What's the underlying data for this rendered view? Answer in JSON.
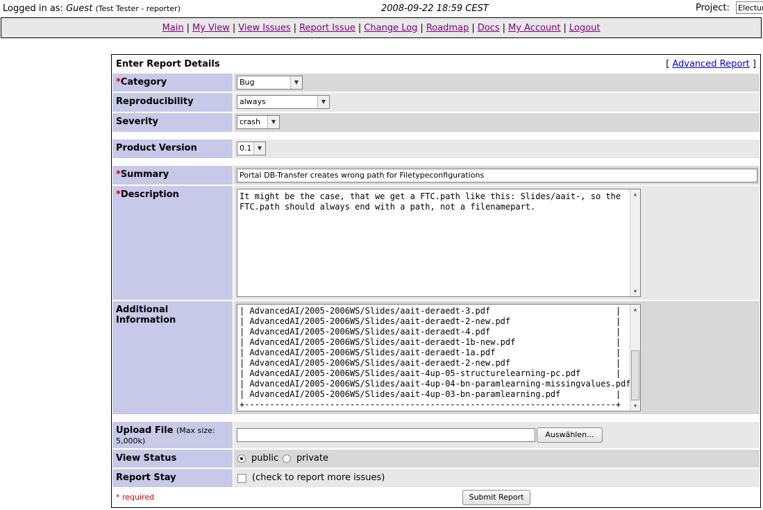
{
  "header": {
    "logged_in_prefix": "Logged in as:",
    "user": "Guest",
    "user_detail": "(Test Tester - reporter)",
    "datetime": "2008-09-22 18:59 CEST",
    "project_label": "Project:",
    "project_value": "Electure"
  },
  "menu": {
    "items": [
      "Main",
      "My View",
      "View Issues",
      "Report Issue",
      "Change Log",
      "Roadmap",
      "Docs",
      "My Account",
      "Logout"
    ],
    "separator": "|"
  },
  "form": {
    "title": "Enter Report Details",
    "advanced_link": "Advanced Report",
    "bracket_open": "[",
    "bracket_close": "]",
    "required_mark": "*",
    "category": {
      "label": "Category",
      "value": "Bug"
    },
    "reproducibility": {
      "label": "Reproducibility",
      "value": "always"
    },
    "severity": {
      "label": "Severity",
      "value": "crash"
    },
    "product_version": {
      "label": "Product Version",
      "value": "0.1"
    },
    "summary": {
      "label": "Summary",
      "value": "Portal DB-Transfer creates wrong path for Filetypeconfigurations"
    },
    "description": {
      "label": "Description",
      "value": "It might be the case, that we get a FTC.path like this: Slides/aait-, so the\nFTC.path should always end with a path, not a filenamepart."
    },
    "additional_info": {
      "label": "Additional Information",
      "value": "| AdvancedAI/2005-2006WS/Slides/aait-deraedt-3.pdf                         |\n| AdvancedAI/2005-2006WS/Slides/aait-deraedt-2-new.pdf                     |\n| AdvancedAI/2005-2006WS/Slides/aait-deraedt-4.pdf                         |\n| AdvancedAI/2005-2006WS/Slides/aait-deraedt-1b-new.pdf                    |\n| AdvancedAI/2005-2006WS/Slides/aait-deraedt-1a.pdf                        |\n| AdvancedAI/2005-2006WS/Slides/aait-deraedt-2-new.pdf                     |\n| AdvancedAI/2005-2006WS/Slides/aait-4up-05-structurelearning-pc.pdf       |\n| AdvancedAI/2005-2006WS/Slides/aait-4up-04-bn-paramlearning-missingvalues.pdf |\n| AdvancedAI/2005-2006WS/Slides/aait-4up-03-bn-paramlearning.pdf           |\n+--------------------------------------------------------------------------+"
    },
    "upload": {
      "label": "Upload File",
      "note": "(Max size: 5,000k)",
      "button": "Auswählen..."
    },
    "view_status": {
      "label": "View Status",
      "public": "public",
      "private": "private",
      "selected": "public"
    },
    "report_stay": {
      "label": "Report Stay",
      "text": "(check to report more issues)"
    },
    "required_note": "* required",
    "submit": "Submit Report"
  }
}
